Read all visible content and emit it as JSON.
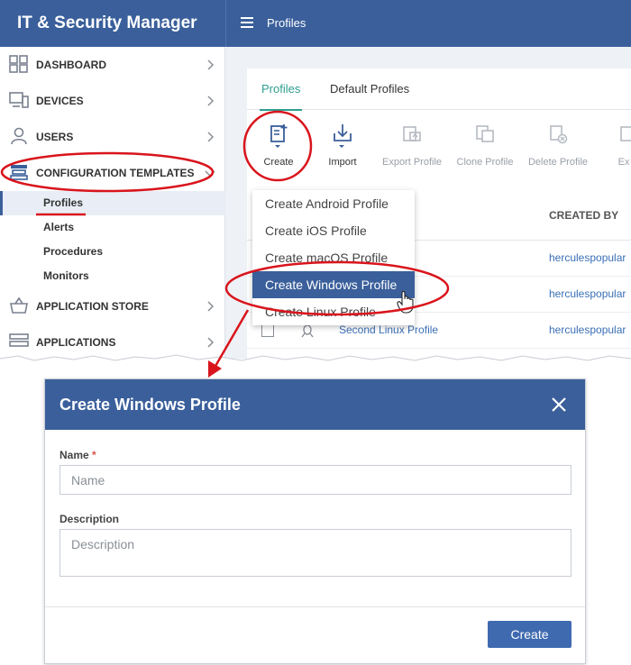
{
  "app": {
    "brand": "IT & Security Manager",
    "page_title": "Profiles"
  },
  "sidebar": {
    "items": [
      {
        "label": "DASHBOARD",
        "icon": "dashboard-icon"
      },
      {
        "label": "DEVICES",
        "icon": "devices-icon"
      },
      {
        "label": "USERS",
        "icon": "users-icon"
      },
      {
        "label": "CONFIGURATION TEMPLATES",
        "icon": "templates-icon"
      },
      {
        "label": "APPLICATION STORE",
        "icon": "store-icon"
      },
      {
        "label": "APPLICATIONS",
        "icon": "applications-icon"
      }
    ],
    "sub_items": [
      "Profiles",
      "Alerts",
      "Procedures",
      "Monitors"
    ]
  },
  "tabs": [
    "Profiles",
    "Default Profiles"
  ],
  "toolbar": {
    "create": "Create",
    "import": "Import",
    "export": "Export Profile",
    "clone": "Clone Profile",
    "delete": "Delete Profile",
    "more": "Ex"
  },
  "table": {
    "created_by_header": "CREATED BY",
    "rows": [
      {
        "name": "",
        "created_by": "herculespopular"
      },
      {
        "name": "",
        "created_by": "herculespopular"
      },
      {
        "name": "Second Linux Profile",
        "created_by": "herculespopular"
      }
    ]
  },
  "dropdown": {
    "items": [
      "Create Android Profile",
      "Create iOS Profile",
      "Create macOS Profile",
      "Create Windows Profile",
      "Create Linux Profile"
    ],
    "selected": "Create Windows Profile"
  },
  "dialog": {
    "title": "Create Windows Profile",
    "name_label": "Name",
    "required_mark": "*",
    "name_placeholder": "Name",
    "description_label": "Description",
    "description_placeholder": "Description",
    "create_button": "Create"
  },
  "colors": {
    "header": "#3a5f9b",
    "accent_tab": "#2e9e8f",
    "link": "#3a6fb5",
    "annotation": "#d9141c"
  }
}
